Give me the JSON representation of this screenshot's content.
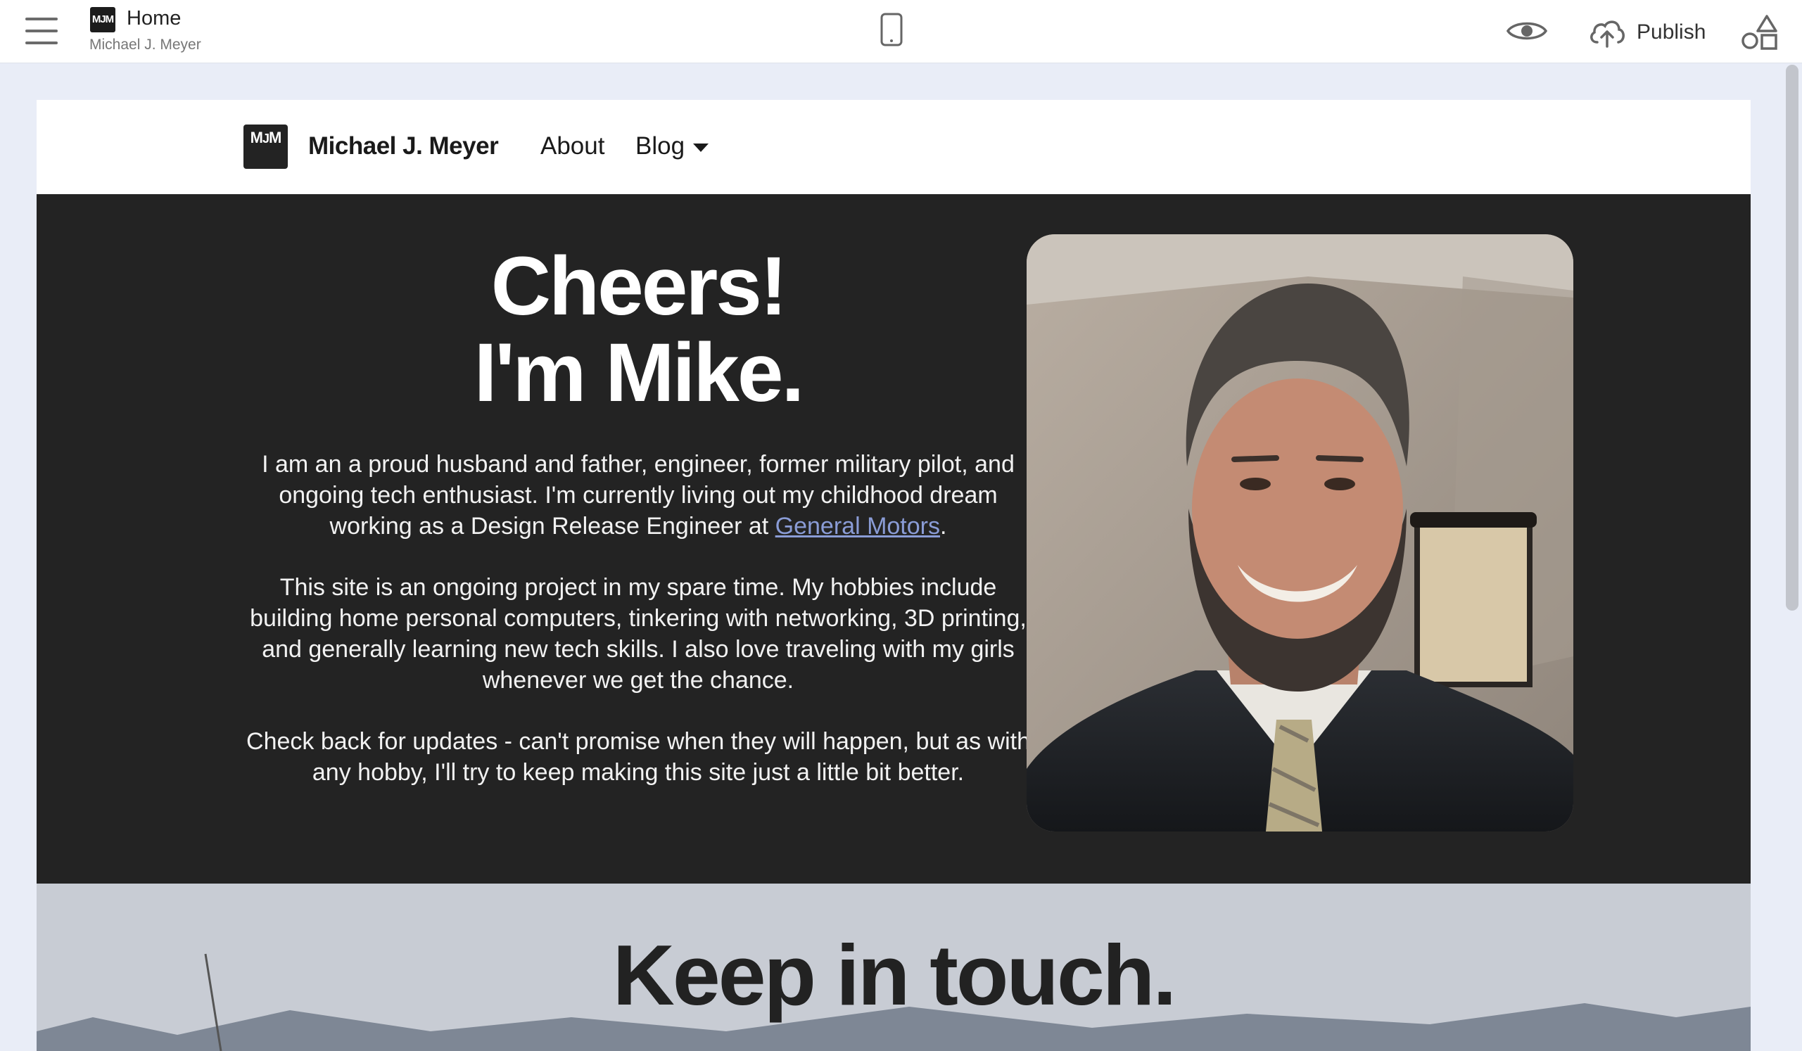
{
  "editor": {
    "page_title": "Home",
    "site_name": "Michael J. Meyer",
    "publish_label": "Publish",
    "logo_text": "MJM"
  },
  "site": {
    "logo_text": "MJM",
    "name": "Michael J. Meyer",
    "nav": {
      "about": "About",
      "blog": "Blog"
    },
    "hero": {
      "heading_line1": "Cheers!",
      "heading_line2": "I'm Mike.",
      "p1_text": "I am an a proud husband and father, engineer, former military pilot, and ongoing tech enthusiast. I'm currently living out my childhood dream working as a Design Release Engineer at ",
      "p1_link": "General Motors",
      "p1_end": ".",
      "p2": "This site is an ongoing project in my spare time. My hobbies include building home personal computers, tinkering with networking, 3D printing, and generally learning new tech skills. I also love traveling with my girls whenever we get the chance.",
      "p3": "Check back for updates - can't promise when they will happen, but as with any hobby, I'll try to keep making this site just a little bit better."
    },
    "contact": {
      "heading": "Keep in touch."
    }
  },
  "icons": {
    "menu": "hamburger-icon",
    "device": "phone-icon",
    "preview": "eye-icon",
    "publish": "cloud-upload-icon",
    "blocks": "shapes-icon"
  },
  "colors": {
    "hero_bg": "#232323",
    "link": "#8a9cd6",
    "editor_bg": "#e9edf7"
  }
}
